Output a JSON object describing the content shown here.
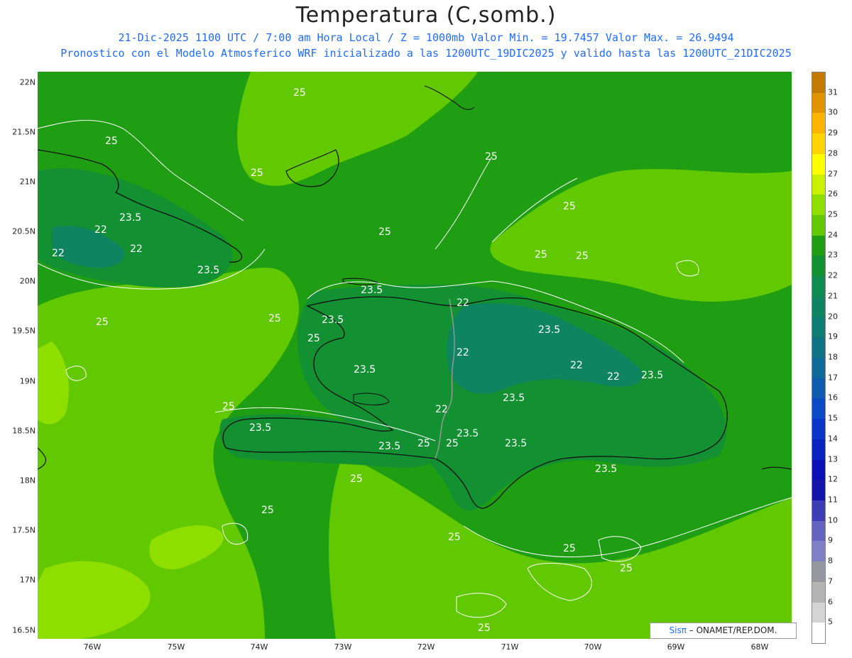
{
  "header": {
    "title": "Temperatura (C,somb.)",
    "subtitle_line1": "21-Dic-2025  1100 UTC / 7:00 am Hora Local / Z = 1000mb   Valor Min. = 19.7457  Valor Max. = 26.9494",
    "subtitle_line2": "Pronostico con el Modelo Atmosferico WRF inicializado a las 1200UTC_19DIC2025 y valido hasta las  1200UTC_21DIC2025"
  },
  "axes": {
    "lat_labels": [
      "22N",
      "21.5N",
      "21N",
      "20.5N",
      "20N",
      "19.5N",
      "19N",
      "18.5N",
      "18N",
      "17.5N",
      "17N",
      "16.5N"
    ],
    "lon_labels": [
      "76W",
      "75W",
      "74W",
      "73W",
      "72W",
      "71W",
      "70W",
      "69W",
      "68W"
    ]
  },
  "colorbar": {
    "labels": [
      "31",
      "30",
      "29",
      "28",
      "27",
      "26",
      "25",
      "24",
      "23",
      "22",
      "21",
      "20",
      "19",
      "18",
      "17",
      "16",
      "15",
      "14",
      "13",
      "12",
      "11",
      "10",
      "9",
      "8",
      "7",
      "6",
      "5"
    ],
    "colors": [
      "#c47a00",
      "#e09400",
      "#ffb400",
      "#ffd400",
      "#ffff00",
      "#c8f000",
      "#8ede00",
      "#62c800",
      "#1f9e14",
      "#129032",
      "#0f8a50",
      "#0e8460",
      "#0e7c70",
      "#0e7484",
      "#0e6a98",
      "#0e5cb0",
      "#0a4ac4",
      "#0a36c8",
      "#0a22c0",
      "#0a10b4",
      "#1414a8",
      "#3c3cb4",
      "#6464c0",
      "#8080c8",
      "#9898a0",
      "#b4b4b4",
      "#d4d4d4",
      "#ffffff"
    ]
  },
  "contour_labels": [
    "25",
    "25",
    "25",
    "25",
    "25",
    "25",
    "25",
    "25",
    "25",
    "25",
    "25",
    "25",
    "25",
    "25",
    "25",
    "25",
    "25",
    "25",
    "25",
    "25",
    "23.5",
    "23.5",
    "23.5",
    "23.5",
    "23.5",
    "23.5",
    "23.5",
    "23.5",
    "23.5",
    "23.5",
    "23.5",
    "23.5",
    "23.5",
    "22",
    "22",
    "22",
    "22",
    "22",
    "22",
    "22",
    "22"
  ],
  "credit": {
    "brand": "Sisπ",
    "text": "– ONAMET/REP.DOM."
  }
}
